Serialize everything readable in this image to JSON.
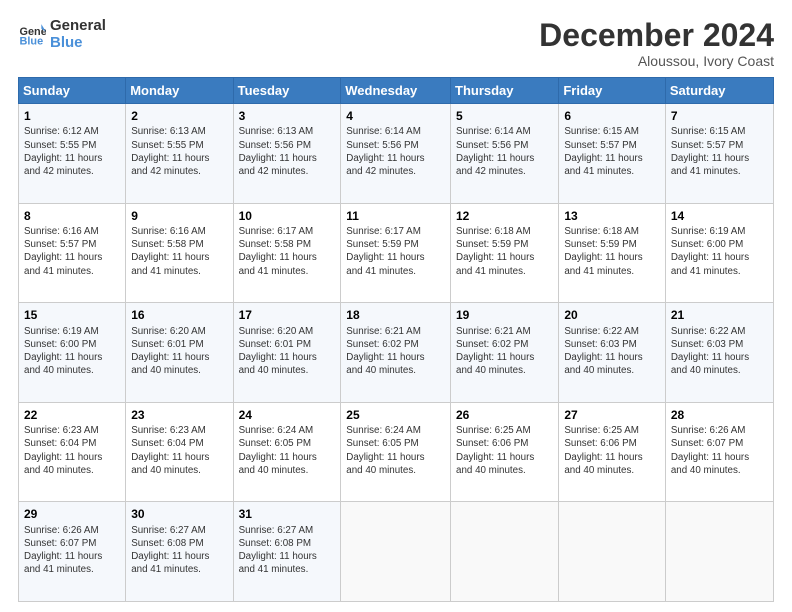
{
  "header": {
    "logo_general": "General",
    "logo_blue": "Blue",
    "month_title": "December 2024",
    "location": "Aloussou, Ivory Coast"
  },
  "days_of_week": [
    "Sunday",
    "Monday",
    "Tuesday",
    "Wednesday",
    "Thursday",
    "Friday",
    "Saturday"
  ],
  "weeks": [
    [
      {
        "day": "1",
        "info": "Sunrise: 6:12 AM\nSunset: 5:55 PM\nDaylight: 11 hours\nand 42 minutes."
      },
      {
        "day": "2",
        "info": "Sunrise: 6:13 AM\nSunset: 5:55 PM\nDaylight: 11 hours\nand 42 minutes."
      },
      {
        "day": "3",
        "info": "Sunrise: 6:13 AM\nSunset: 5:56 PM\nDaylight: 11 hours\nand 42 minutes."
      },
      {
        "day": "4",
        "info": "Sunrise: 6:14 AM\nSunset: 5:56 PM\nDaylight: 11 hours\nand 42 minutes."
      },
      {
        "day": "5",
        "info": "Sunrise: 6:14 AM\nSunset: 5:56 PM\nDaylight: 11 hours\nand 42 minutes."
      },
      {
        "day": "6",
        "info": "Sunrise: 6:15 AM\nSunset: 5:57 PM\nDaylight: 11 hours\nand 41 minutes."
      },
      {
        "day": "7",
        "info": "Sunrise: 6:15 AM\nSunset: 5:57 PM\nDaylight: 11 hours\nand 41 minutes."
      }
    ],
    [
      {
        "day": "8",
        "info": "Sunrise: 6:16 AM\nSunset: 5:57 PM\nDaylight: 11 hours\nand 41 minutes."
      },
      {
        "day": "9",
        "info": "Sunrise: 6:16 AM\nSunset: 5:58 PM\nDaylight: 11 hours\nand 41 minutes."
      },
      {
        "day": "10",
        "info": "Sunrise: 6:17 AM\nSunset: 5:58 PM\nDaylight: 11 hours\nand 41 minutes."
      },
      {
        "day": "11",
        "info": "Sunrise: 6:17 AM\nSunset: 5:59 PM\nDaylight: 11 hours\nand 41 minutes."
      },
      {
        "day": "12",
        "info": "Sunrise: 6:18 AM\nSunset: 5:59 PM\nDaylight: 11 hours\nand 41 minutes."
      },
      {
        "day": "13",
        "info": "Sunrise: 6:18 AM\nSunset: 5:59 PM\nDaylight: 11 hours\nand 41 minutes."
      },
      {
        "day": "14",
        "info": "Sunrise: 6:19 AM\nSunset: 6:00 PM\nDaylight: 11 hours\nand 41 minutes."
      }
    ],
    [
      {
        "day": "15",
        "info": "Sunrise: 6:19 AM\nSunset: 6:00 PM\nDaylight: 11 hours\nand 40 minutes."
      },
      {
        "day": "16",
        "info": "Sunrise: 6:20 AM\nSunset: 6:01 PM\nDaylight: 11 hours\nand 40 minutes."
      },
      {
        "day": "17",
        "info": "Sunrise: 6:20 AM\nSunset: 6:01 PM\nDaylight: 11 hours\nand 40 minutes."
      },
      {
        "day": "18",
        "info": "Sunrise: 6:21 AM\nSunset: 6:02 PM\nDaylight: 11 hours\nand 40 minutes."
      },
      {
        "day": "19",
        "info": "Sunrise: 6:21 AM\nSunset: 6:02 PM\nDaylight: 11 hours\nand 40 minutes."
      },
      {
        "day": "20",
        "info": "Sunrise: 6:22 AM\nSunset: 6:03 PM\nDaylight: 11 hours\nand 40 minutes."
      },
      {
        "day": "21",
        "info": "Sunrise: 6:22 AM\nSunset: 6:03 PM\nDaylight: 11 hours\nand 40 minutes."
      }
    ],
    [
      {
        "day": "22",
        "info": "Sunrise: 6:23 AM\nSunset: 6:04 PM\nDaylight: 11 hours\nand 40 minutes."
      },
      {
        "day": "23",
        "info": "Sunrise: 6:23 AM\nSunset: 6:04 PM\nDaylight: 11 hours\nand 40 minutes."
      },
      {
        "day": "24",
        "info": "Sunrise: 6:24 AM\nSunset: 6:05 PM\nDaylight: 11 hours\nand 40 minutes."
      },
      {
        "day": "25",
        "info": "Sunrise: 6:24 AM\nSunset: 6:05 PM\nDaylight: 11 hours\nand 40 minutes."
      },
      {
        "day": "26",
        "info": "Sunrise: 6:25 AM\nSunset: 6:06 PM\nDaylight: 11 hours\nand 40 minutes."
      },
      {
        "day": "27",
        "info": "Sunrise: 6:25 AM\nSunset: 6:06 PM\nDaylight: 11 hours\nand 40 minutes."
      },
      {
        "day": "28",
        "info": "Sunrise: 6:26 AM\nSunset: 6:07 PM\nDaylight: 11 hours\nand 40 minutes."
      }
    ],
    [
      {
        "day": "29",
        "info": "Sunrise: 6:26 AM\nSunset: 6:07 PM\nDaylight: 11 hours\nand 41 minutes."
      },
      {
        "day": "30",
        "info": "Sunrise: 6:27 AM\nSunset: 6:08 PM\nDaylight: 11 hours\nand 41 minutes."
      },
      {
        "day": "31",
        "info": "Sunrise: 6:27 AM\nSunset: 6:08 PM\nDaylight: 11 hours\nand 41 minutes."
      },
      {
        "day": "",
        "info": ""
      },
      {
        "day": "",
        "info": ""
      },
      {
        "day": "",
        "info": ""
      },
      {
        "day": "",
        "info": ""
      }
    ]
  ]
}
